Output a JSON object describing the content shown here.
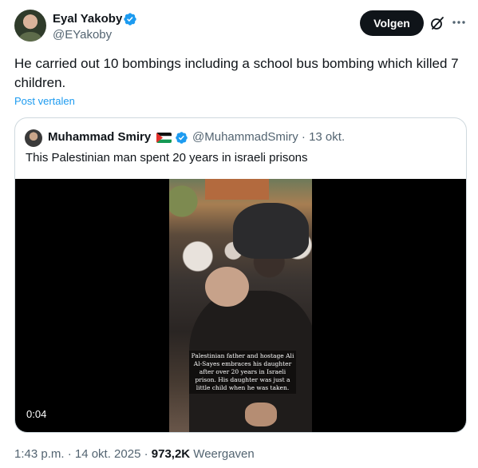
{
  "author": {
    "name": "Eyal Yakoby",
    "handle": "@EYakoby"
  },
  "actions": {
    "follow_label": "Volgen"
  },
  "tweet": {
    "text": "He carried out 10 bombings including a school bus bombing which killed 7 children.",
    "translate_label": "Post vertalen"
  },
  "quote": {
    "name": "Muhammad Smiry",
    "meta": "@MuhammadSmiry · 13 okt.",
    "text": "This Palestinian man spent 20 years in israeli prisons",
    "video": {
      "caption": "Palestinian father and hostage Ali Al-Sayes embraces his daughter after over 20 years in Israeli prison. His daughter was just a little child when he was taken.",
      "duration": "0:04"
    }
  },
  "footer": {
    "time_date": "1:43 p.m. · 14 okt. 2025 · ",
    "views_count": "973,2K",
    "views_label": " Weergaven"
  },
  "colors": {
    "accent": "#1d9bf0",
    "text": "#0f1419",
    "secondary": "#536471",
    "border": "#cfd9de"
  },
  "icons": [
    "verified-badge-icon",
    "grok-icon",
    "more-icon",
    "palestine-flag-icon"
  ]
}
